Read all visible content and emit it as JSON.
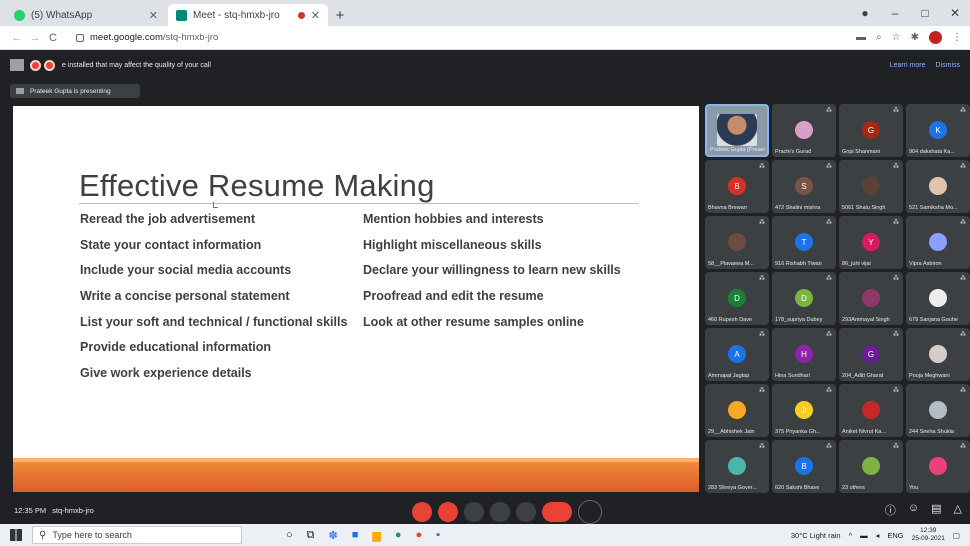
{
  "browser": {
    "tabs": [
      {
        "title": "(5) WhatsApp",
        "color": "#25d366",
        "active": false
      },
      {
        "title": "Meet - stq-hmxb-jro",
        "color": "#00897b",
        "active": true
      }
    ],
    "new_tab": "+",
    "window_controls": [
      "●",
      "–",
      "□",
      "✕"
    ],
    "url_host": "meet.google.com",
    "url_path": "/stq-hmxb-jro",
    "nav_icons": [
      "←",
      "→",
      "C"
    ],
    "right_icons": [
      "▬",
      "⌕",
      "☆",
      "✱"
    ]
  },
  "meet": {
    "warning_message": "e installed that may affect the quality of your call",
    "warning_links": [
      "Learn more",
      "Dismiss"
    ],
    "presenting_banner": "Prateek Gupta is presenting",
    "meeting_time": "12:35 PM",
    "meeting_code": "stq-hmxb-jro"
  },
  "slide": {
    "title": "Effective Resume Making",
    "left_items": [
      "Reread the job advertisement",
      "State your contact information",
      "Include your social media accounts",
      "Write a concise personal statement",
      "List your soft and technical / functional skills",
      "Provide educational information",
      "Give work experience details"
    ],
    "right_items": [
      "Mention hobbies and interests",
      "Highlight miscellaneous skills",
      "Declare your willingness to learn new skills",
      "Proofread and edit the resume",
      "Look at other resume samples online"
    ]
  },
  "participants": [
    {
      "name": "Prateek Gupta (Presenting)",
      "initial": "",
      "color": "#5f6368",
      "self": true
    },
    {
      "name": "Prachi's Gurad",
      "initial": "",
      "color": "#d8a0c8"
    },
    {
      "name": "Gopi Shanmani",
      "initial": "G",
      "color": "#a52714"
    },
    {
      "name": "904 dakshata Ka...",
      "initial": "K",
      "color": "#1a73e8"
    },
    {
      "name": "Bhavna Brewan",
      "initial": "B",
      "color": "#d93025"
    },
    {
      "name": "472 Shalini mishra",
      "initial": "S",
      "color": "#795548"
    },
    {
      "name": "5061 Shalu Singh",
      "initial": "",
      "color": "#5d4037"
    },
    {
      "name": "521 Samiksha Mo...",
      "initial": "",
      "color": "#e0c3a8"
    },
    {
      "name": "58__Plavaeea M...",
      "initial": "",
      "color": "#6d4c41"
    },
    {
      "name": "916 Rishabh Tiwari",
      "initial": "T",
      "color": "#1a73e8"
    },
    {
      "name": "86_juhi vijai",
      "initial": "Y",
      "color": "#d81b60"
    },
    {
      "name": "Vipra Asbiron",
      "initial": "",
      "color": "#8c9eff"
    },
    {
      "name": "460 Rupesh Dave",
      "initial": "D",
      "color": "#188038"
    },
    {
      "name": "178_supriya Dubey",
      "initial": "D",
      "color": "#7cb342"
    },
    {
      "name": "293Ammayal Singh",
      "initial": "",
      "color": "#8d3a6b"
    },
    {
      "name": "679 Sanjana Gouhe",
      "initial": "",
      "color": "#eeeeee"
    },
    {
      "name": "Ammapal Jagtap",
      "initial": "A",
      "color": "#1a73e8"
    },
    {
      "name": "Hina Sundhari",
      "initial": "H",
      "color": "#8e24aa"
    },
    {
      "name": "204_Aditi Gharat",
      "initial": "G",
      "color": "#6a1b9a"
    },
    {
      "name": "Pooja Meghwani",
      "initial": "",
      "color": "#d7ccc8"
    },
    {
      "name": "29__Abhishek Jain",
      "initial": "",
      "color": "#f9a825"
    },
    {
      "name": "375 Priyanka Gh...",
      "initial": "Jr",
      "color": "#f9ce1d"
    },
    {
      "name": "Aniket Nivrut Ka...",
      "initial": "",
      "color": "#c62828"
    },
    {
      "name": "244 Sneha Shukla",
      "initial": "",
      "color": "#b0bec5"
    },
    {
      "name": "283 Shreya Gover...",
      "initial": "",
      "color": "#4db6ac"
    },
    {
      "name": "620 Sakshi Bhave",
      "initial": "B",
      "color": "#1a73e8"
    },
    {
      "name": "23 others",
      "initial": "",
      "color": "#7cb342"
    },
    {
      "name": "You",
      "initial": "",
      "color": "#ec407a"
    }
  ],
  "taskbar": {
    "search_placeholder": "Type here to search",
    "weather": "30°C  Light rain",
    "language": "ENG",
    "time": "12:39",
    "date": "25-09-2021"
  }
}
